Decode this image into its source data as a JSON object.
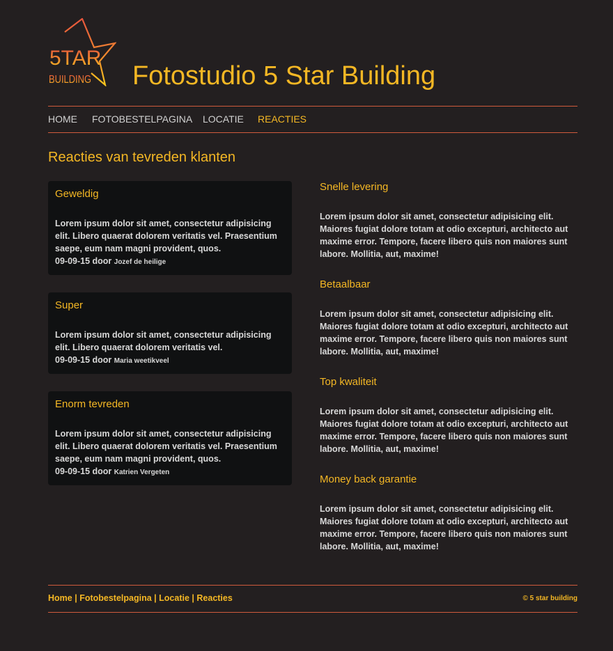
{
  "header": {
    "logo": {
      "icon": "star-logo-icon",
      "line1": "5TAR",
      "line2": "BUILDING"
    },
    "title": "Fotostudio 5 Star Building"
  },
  "nav": {
    "items": [
      {
        "label": "HOME",
        "active": false
      },
      {
        "label": "FOTOBESTELPAGINA",
        "active": false
      },
      {
        "label": "LOCATIE",
        "active": false
      },
      {
        "label": "REACTIES",
        "active": true
      }
    ]
  },
  "main": {
    "title": "Reacties van tevreden klanten",
    "reviews": [
      {
        "title": "Geweldig",
        "body": "Lorem ipsum dolor sit amet, consectetur adipisicing elit. Libero quaerat dolorem veritatis vel. Praesentium saepe, eum nam magni provident, quos.",
        "date": "09-09-15 door",
        "author": "Jozef de heilige"
      },
      {
        "title": "Super",
        "body": "Lorem ipsum dolor sit amet, consectetur adipisicing elit. Libero quaerat dolorem veritatis vel.",
        "date": "09-09-15 door",
        "author": "Maria weetikveel"
      },
      {
        "title": "Enorm tevreden",
        "body": "Lorem ipsum dolor sit amet, consectetur adipisicing elit. Libero quaerat dolorem veritatis vel. Praesentium saepe, eum nam magni provident, quos.",
        "date": "09-09-15 door",
        "author": "Katrien Vergeten"
      }
    ],
    "features": [
      {
        "title": "Snelle levering",
        "body": "Lorem ipsum dolor sit amet, consectetur adipisicing elit. Maiores fugiat dolore totam at odio excepturi, architecto aut maxime error. Tempore, facere libero quis non maiores sunt labore. Mollitia, aut, maxime!"
      },
      {
        "title": "Betaalbaar",
        "body": "Lorem ipsum dolor sit amet, consectetur adipisicing elit. Maiores fugiat dolore totam at odio excepturi, architecto aut maxime error. Tempore, facere libero quis non maiores sunt labore. Mollitia, aut, maxime!"
      },
      {
        "title": "Top kwaliteit",
        "body": "Lorem ipsum dolor sit amet, consectetur adipisicing elit. Maiores fugiat dolore totam at odio excepturi, architecto aut maxime error. Tempore, facere libero quis non maiores sunt labore. Mollitia, aut, maxime!"
      },
      {
        "title": "Money back garantie",
        "body": "Lorem ipsum dolor sit amet, consectetur adipisicing elit. Maiores fugiat dolore totam at odio excepturi, architecto aut maxime error. Tempore, facere libero quis non maiores sunt labore. Mollitia, aut, maxime!"
      }
    ]
  },
  "footer": {
    "links": [
      "Home",
      "Fotobestelpagina",
      "Locatie",
      "Reacties"
    ],
    "separator": "|",
    "copyright": "© 5 star building"
  },
  "colors": {
    "background": "#231f20",
    "accent": "#f4b724",
    "rule": "#d05a3c",
    "card": "#101112",
    "text": "#d8d8d8"
  }
}
